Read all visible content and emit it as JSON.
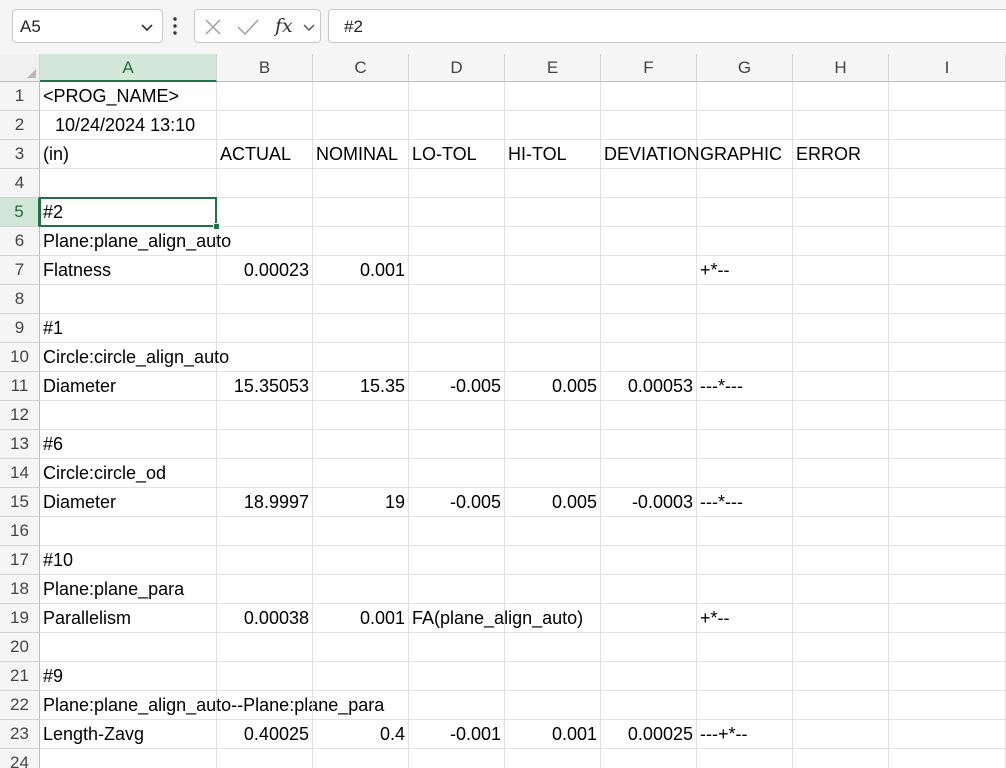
{
  "formula_bar": {
    "name_box": "A5",
    "formula": "#2",
    "fx_label": "fx"
  },
  "columns": [
    "A",
    "B",
    "C",
    "D",
    "E",
    "F",
    "G",
    "H",
    "I"
  ],
  "selected_cell": "A5",
  "rows": [
    {
      "n": "1",
      "cells": [
        "<PROG_NAME>",
        "",
        "",
        "",
        "",
        "",
        "",
        "",
        ""
      ]
    },
    {
      "n": "2",
      "cells": [
        "10/24/2024 13:10",
        "",
        "",
        "",
        "",
        "",
        "",
        "",
        ""
      ]
    },
    {
      "n": "3",
      "cells": [
        "(in)",
        "ACTUAL",
        "NOMINAL",
        "LO-TOL",
        "HI-TOL",
        "DEVIATION",
        "GRAPHIC",
        "ERROR",
        ""
      ]
    },
    {
      "n": "4",
      "cells": [
        "",
        "",
        "",
        "",
        "",
        "",
        "",
        "",
        ""
      ]
    },
    {
      "n": "5",
      "cells": [
        "#2",
        "",
        "",
        "",
        "",
        "",
        "",
        "",
        ""
      ]
    },
    {
      "n": "6",
      "cells": [
        "Plane:plane_align_auto",
        "",
        "",
        "",
        "",
        "",
        "",
        "",
        ""
      ]
    },
    {
      "n": "7",
      "cells": [
        "Flatness",
        "0.00023",
        "0.001",
        "",
        "",
        "",
        "+*--",
        "",
        ""
      ]
    },
    {
      "n": "8",
      "cells": [
        "",
        "",
        "",
        "",
        "",
        "",
        "",
        "",
        ""
      ]
    },
    {
      "n": "9",
      "cells": [
        "#1",
        "",
        "",
        "",
        "",
        "",
        "",
        "",
        ""
      ]
    },
    {
      "n": "10",
      "cells": [
        "Circle:circle_align_auto",
        "",
        "",
        "",
        "",
        "",
        "",
        "",
        ""
      ]
    },
    {
      "n": "11",
      "cells": [
        "Diameter",
        "15.35053",
        "15.35",
        "-0.005",
        "0.005",
        "0.00053",
        "---*---",
        "",
        ""
      ]
    },
    {
      "n": "12",
      "cells": [
        "",
        "",
        "",
        "",
        "",
        "",
        "",
        "",
        ""
      ]
    },
    {
      "n": "13",
      "cells": [
        "#6",
        "",
        "",
        "",
        "",
        "",
        "",
        "",
        ""
      ]
    },
    {
      "n": "14",
      "cells": [
        "Circle:circle_od",
        "",
        "",
        "",
        "",
        "",
        "",
        "",
        ""
      ]
    },
    {
      "n": "15",
      "cells": [
        "Diameter",
        "18.9997",
        "19",
        "-0.005",
        "0.005",
        "-0.0003",
        "---*---",
        "",
        ""
      ]
    },
    {
      "n": "16",
      "cells": [
        "",
        "",
        "",
        "",
        "",
        "",
        "",
        "",
        ""
      ]
    },
    {
      "n": "17",
      "cells": [
        "#10",
        "",
        "",
        "",
        "",
        "",
        "",
        "",
        ""
      ]
    },
    {
      "n": "18",
      "cells": [
        "Plane:plane_para",
        "",
        "",
        "",
        "",
        "",
        "",
        "",
        ""
      ]
    },
    {
      "n": "19",
      "cells": [
        "Parallelism",
        "0.00038",
        "0.001",
        "FA(plane_align_auto)",
        "",
        "",
        "+*--",
        "",
        ""
      ]
    },
    {
      "n": "20",
      "cells": [
        "",
        "",
        "",
        "",
        "",
        "",
        "",
        "",
        ""
      ]
    },
    {
      "n": "21",
      "cells": [
        "#9",
        "",
        "",
        "",
        "",
        "",
        "",
        "",
        ""
      ]
    },
    {
      "n": "22",
      "cells": [
        "Plane:plane_align_auto--Plane:plane_para",
        "",
        "",
        "",
        "",
        "",
        "",
        "",
        ""
      ]
    },
    {
      "n": "23",
      "cells": [
        "Length-Zavg",
        "0.40025",
        "0.4",
        "-0.001",
        "0.001",
        "0.00025",
        "---+*--",
        "",
        ""
      ]
    },
    {
      "n": "24",
      "cells": [
        "",
        "",
        "",
        "",
        "",
        "",
        "",
        "",
        ""
      ]
    }
  ],
  "theme": {
    "accent": "#217346",
    "header_selected_bg": "#d3e7d9"
  }
}
